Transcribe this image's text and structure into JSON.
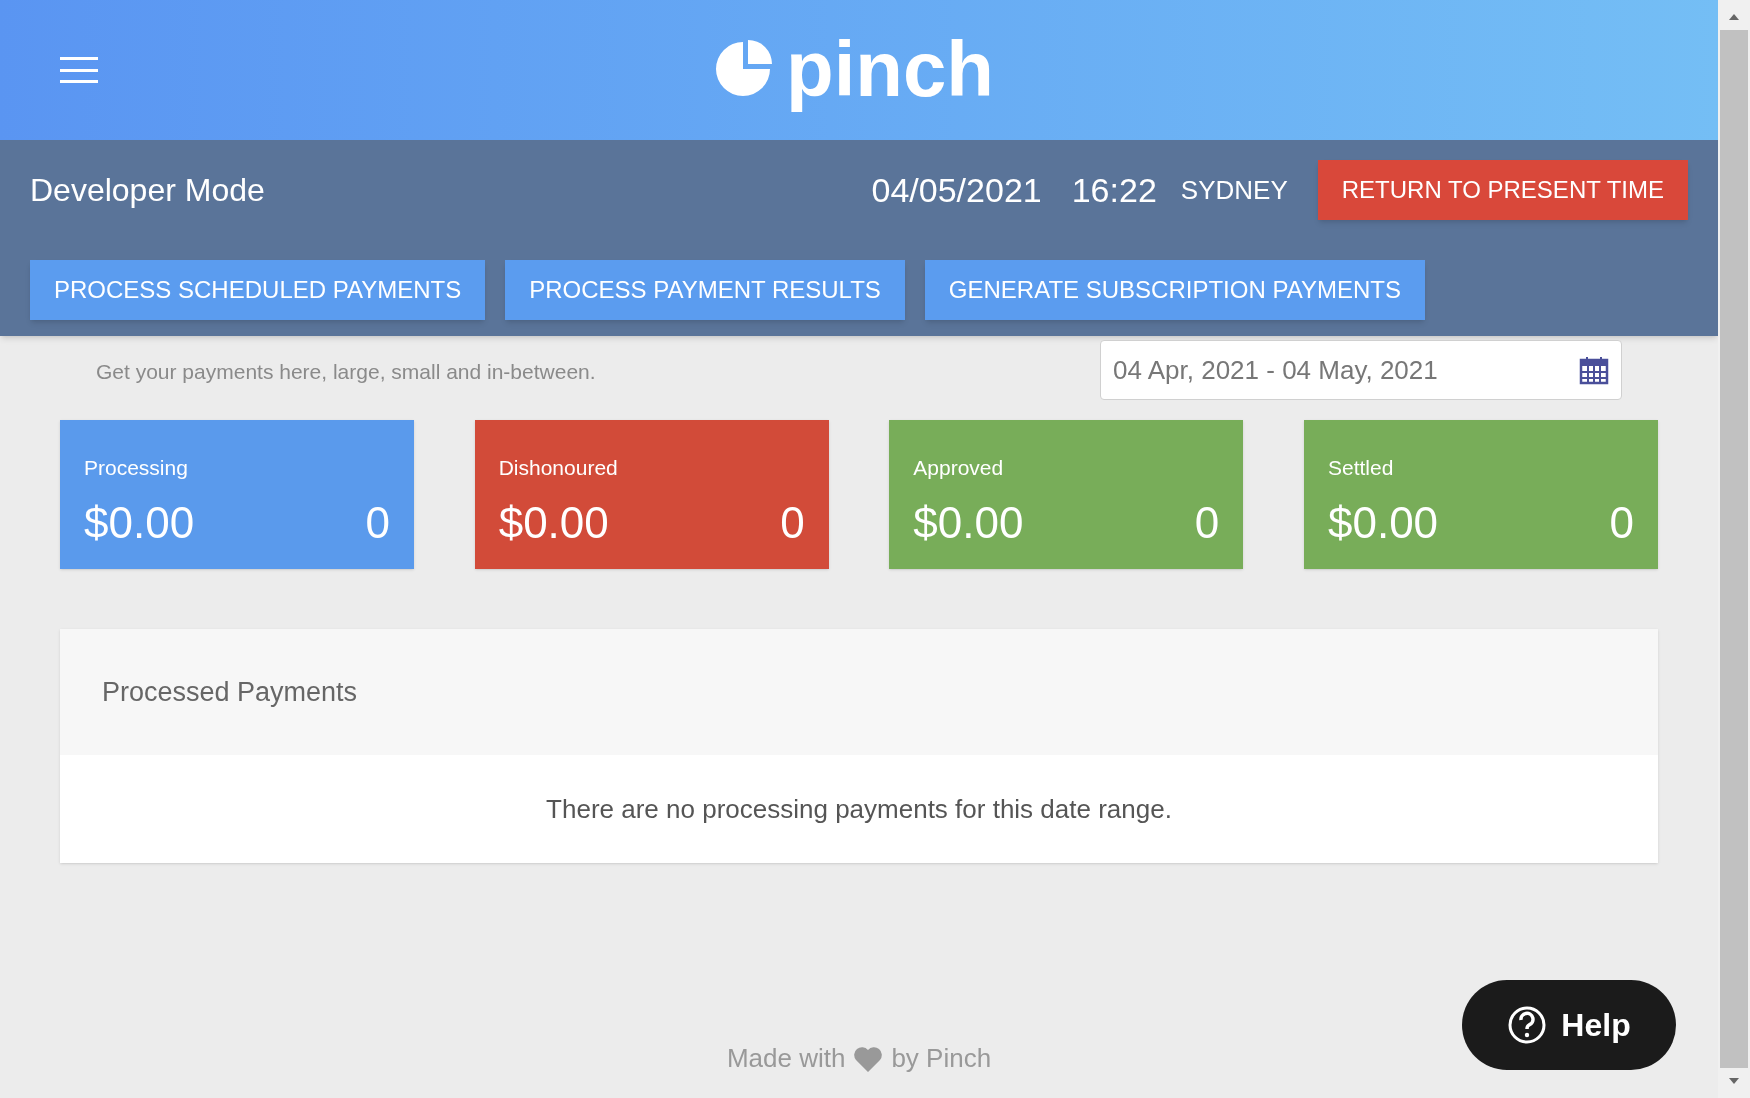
{
  "header": {
    "logo": "pinch"
  },
  "developer_bar": {
    "title": "Developer Mode",
    "date": "04/05/2021",
    "time": "16:22",
    "city": "SYDNEY",
    "return_button": "RETURN TO PRESENT TIME",
    "actions": [
      "PROCESS SCHEDULED PAYMENTS",
      "PROCESS PAYMENT RESULTS",
      "GENERATE SUBSCRIPTION PAYMENTS"
    ]
  },
  "subtitle": "Get your payments here, large, small and in-between.",
  "date_range": {
    "value": "04 Apr, 2021 - 04 May, 2021"
  },
  "cards": [
    {
      "label": "Processing",
      "amount": "$0.00",
      "count": "0",
      "color": "#5a9aec"
    },
    {
      "label": "Dishonoured",
      "amount": "$0.00",
      "count": "0",
      "color": "#d24b39"
    },
    {
      "label": "Approved",
      "amount": "$0.00",
      "count": "0",
      "color": "#78ad59"
    },
    {
      "label": "Settled",
      "amount": "$0.00",
      "count": "0",
      "color": "#78ad59"
    }
  ],
  "panel": {
    "title": "Processed Payments",
    "empty_message": "There are no processing payments for this date range."
  },
  "footer": {
    "before": "Made with",
    "after": "by Pinch"
  },
  "help": {
    "label": "Help"
  }
}
